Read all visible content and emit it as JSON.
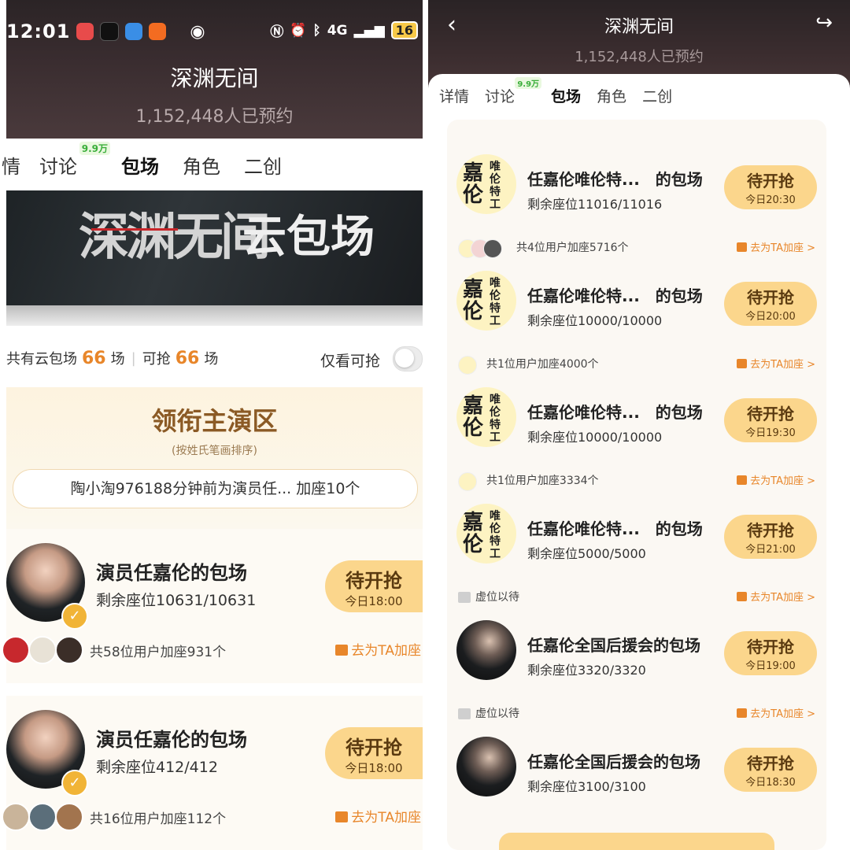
{
  "left": {
    "status": {
      "time": "12:01",
      "battery": "16",
      "network": "4G"
    },
    "title": "深渊无间",
    "subtitle": "1,152,448人已预约",
    "tabs": [
      {
        "label": "情",
        "active": false
      },
      {
        "label": "讨论",
        "badge": "9.9万",
        "active": false
      },
      {
        "label": "包场",
        "active": true
      },
      {
        "label": "角色",
        "active": false
      },
      {
        "label": "二创",
        "active": false
      }
    ],
    "banner": {
      "text1": "深渊无间",
      "text2": "云包场"
    },
    "counts": {
      "total_label": "共有云包场",
      "total": "66",
      "unit": "场",
      "grab_label": "可抢",
      "grab": "66",
      "grab_unit": "场"
    },
    "only_grab_label": "仅看可抢",
    "lead": {
      "title": "领衔主演区",
      "note": "(按姓氏笔画排序)",
      "ticker": "陶小淘976188分钟前为演员任... 加座10个"
    },
    "cards": [
      {
        "name": "演员任嘉伦的包场",
        "seats": "剩余座位10631/10631",
        "btn_main": "待开抢",
        "btn_time": "今日18:00",
        "users": "共58位用户加座931个",
        "goadd": "去为TA加座"
      },
      {
        "name": "演员任嘉伦的包场",
        "seats": "剩余座位412/412",
        "btn_main": "待开抢",
        "btn_time": "今日18:00",
        "users": "共16位用户加座112个",
        "goadd": "去为TA加座"
      }
    ]
  },
  "right": {
    "title": "深渊无间",
    "subtitle": "1,152,448人已预约",
    "tabs": [
      {
        "label": "详情",
        "active": false
      },
      {
        "label": "讨论",
        "badge": "9.9万",
        "active": false
      },
      {
        "label": "包场",
        "active": true
      },
      {
        "label": "角色",
        "active": false
      },
      {
        "label": "二创",
        "active": false
      }
    ],
    "cards": [
      {
        "name": "任嘉伦唯伦特...　的包场",
        "seats": "剩余座位11016/11016",
        "btn_main": "待开抢",
        "btn_time": "今日20:30",
        "users": "共4位用户加座5716个",
        "goadd": "去为TA加座 >"
      },
      {
        "name": "任嘉伦唯伦特...　的包场",
        "seats": "剩余座位10000/10000",
        "btn_main": "待开抢",
        "btn_time": "今日20:00",
        "users": "共1位用户加座4000个",
        "goadd": "去为TA加座 >"
      },
      {
        "name": "任嘉伦唯伦特...　的包场",
        "seats": "剩余座位10000/10000",
        "btn_main": "待开抢",
        "btn_time": "今日19:30",
        "users": "共1位用户加座3334个",
        "goadd": "去为TA加座 >"
      },
      {
        "name": "任嘉伦唯伦特...　的包场",
        "seats": "剩余座位5000/5000",
        "btn_main": "待开抢",
        "btn_time": "今日21:00",
        "users": "虚位以待",
        "goadd": "去为TA加座 >"
      },
      {
        "name": "任嘉伦全国后援会的包场",
        "seats": "剩余座位3320/3320",
        "btn_main": "待开抢",
        "btn_time": "今日19:00",
        "users": "虚位以待",
        "goadd": "去为TA加座 >"
      },
      {
        "name": "任嘉伦全国后援会的包场",
        "seats": "剩余座位3100/3100",
        "btn_main": "待开抢",
        "btn_time": "今日18:30"
      }
    ]
  },
  "colors": {
    "accent": "#e8862a",
    "button": "#fbd68c",
    "lead_title": "#8b5a25"
  },
  "icons": [
    "back-icon",
    "share-icon",
    "eye-icon",
    "gift-icon",
    "seat-icon",
    "verified-icon"
  ]
}
